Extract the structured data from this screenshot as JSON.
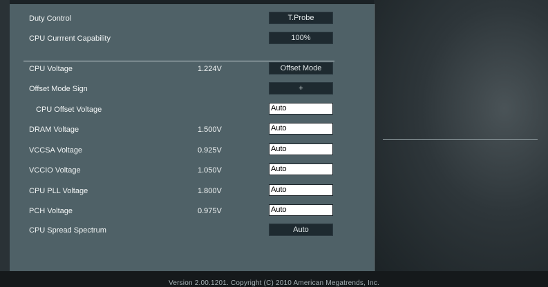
{
  "rows": [
    {
      "label": "Duty Control",
      "value": "",
      "control": "T.Probe"
    },
    {
      "label": "CPU Currrent Capability",
      "value": "",
      "control": "100%"
    },
    {
      "label": "CPU Voltage",
      "value": "1.224V",
      "control": "Offset Mode"
    },
    {
      "label": "Offset Mode Sign",
      "value": "",
      "control": "+"
    },
    {
      "label": "CPU Offset Voltage",
      "value": "",
      "control": "Auto"
    },
    {
      "label": "DRAM Voltage",
      "value": "1.500V",
      "control": "Auto"
    },
    {
      "label": "VCCSA Voltage",
      "value": "0.925V",
      "control": "Auto"
    },
    {
      "label": "VCCIO Voltage",
      "value": "1.050V",
      "control": "Auto"
    },
    {
      "label": "CPU PLL Voltage",
      "value": "1.800V",
      "control": "Auto"
    },
    {
      "label": "PCH Voltage",
      "value": "0.975V",
      "control": "Auto"
    },
    {
      "label": "CPU Spread Spectrum",
      "value": "",
      "control": "Auto"
    }
  ],
  "footer": {
    "version": "Version  2.00.1201.  Copyright  (C)  2010  American  Megatrends,  Inc."
  }
}
